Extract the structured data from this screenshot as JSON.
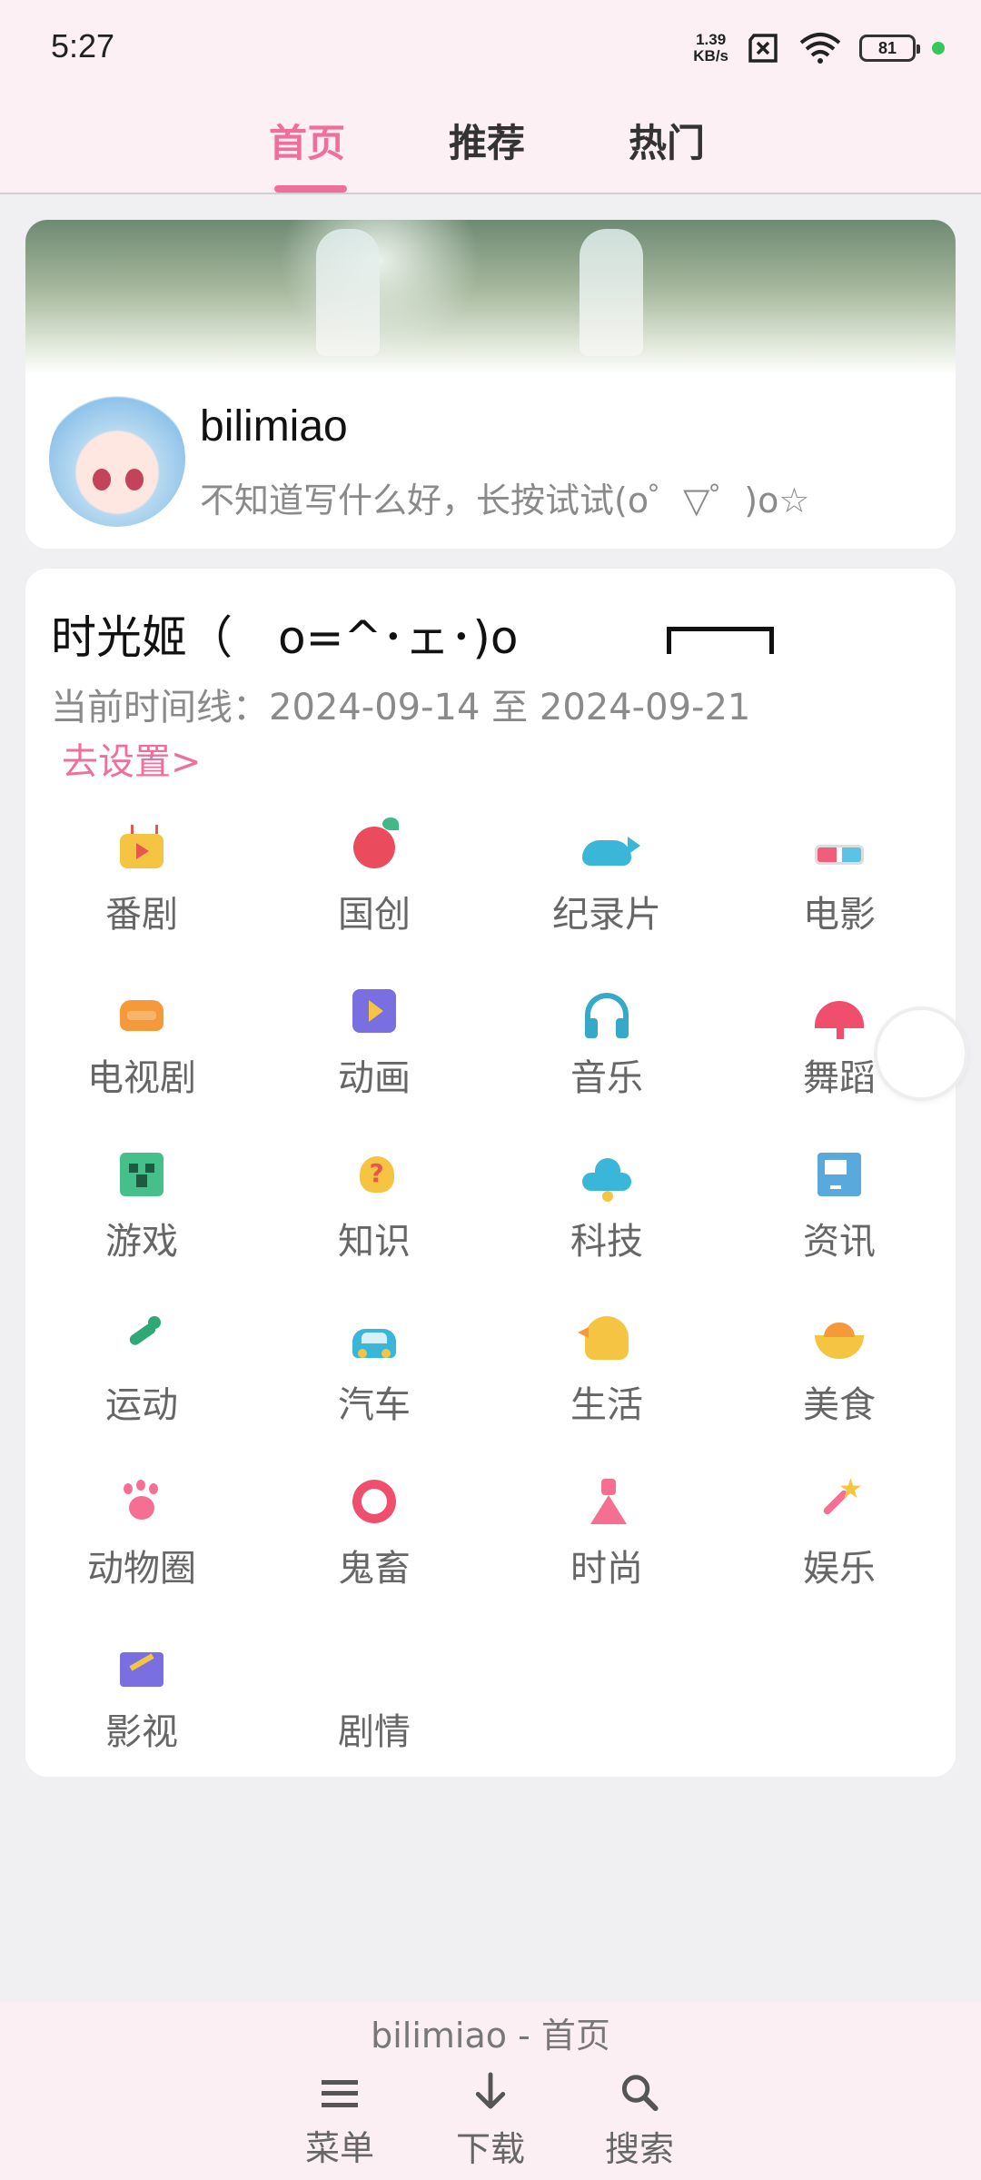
{
  "status_bar": {
    "time": "5:27",
    "net_speed_value": "1.39",
    "net_speed_unit": "KB/s",
    "battery": "81"
  },
  "tabs": [
    {
      "label": "首页",
      "active": true
    },
    {
      "label": "推荐",
      "active": false
    },
    {
      "label": "热门",
      "active": false
    }
  ],
  "profile": {
    "username": "bilimiao",
    "bio": "不知道写什么好，长按试试(o゜▽゜)o☆"
  },
  "timeline_card": {
    "title": "时光姬（　o=^･ェ･)o　",
    "timeline_text": "当前时间线：2024-09-14 至 2024-09-21",
    "settings_link": "去设置>"
  },
  "categories": [
    {
      "label": "番剧",
      "icon": "tv-icon"
    },
    {
      "label": "国创",
      "icon": "gourd-icon"
    },
    {
      "label": "纪录片",
      "icon": "whale-icon"
    },
    {
      "label": "电影",
      "icon": "3d-glasses-icon"
    },
    {
      "label": "电视剧",
      "icon": "sofa-icon"
    },
    {
      "label": "动画",
      "icon": "play-icon"
    },
    {
      "label": "音乐",
      "icon": "headphones-icon"
    },
    {
      "label": "舞蹈",
      "icon": "fan-icon"
    },
    {
      "label": "游戏",
      "icon": "creeper-icon"
    },
    {
      "label": "知识",
      "icon": "lightbulb-icon"
    },
    {
      "label": "科技",
      "icon": "ufo-icon"
    },
    {
      "label": "资讯",
      "icon": "newspaper-icon"
    },
    {
      "label": "运动",
      "icon": "runner-icon"
    },
    {
      "label": "汽车",
      "icon": "car-icon"
    },
    {
      "label": "生活",
      "icon": "duck-icon"
    },
    {
      "label": "美食",
      "icon": "food-bowl-icon"
    },
    {
      "label": "动物圈",
      "icon": "paw-icon"
    },
    {
      "label": "鬼畜",
      "icon": "clown-icon"
    },
    {
      "label": "时尚",
      "icon": "dress-icon"
    },
    {
      "label": "娱乐",
      "icon": "magic-wand-icon"
    },
    {
      "label": "影视",
      "icon": "clapperboard-icon"
    },
    {
      "label": "剧情",
      "icon": ""
    }
  ],
  "bottom_bar": {
    "title": "bilimiao - 首页",
    "buttons": [
      {
        "label": "菜单",
        "icon": "menu-icon"
      },
      {
        "label": "下载",
        "icon": "download-icon"
      },
      {
        "label": "搜索",
        "icon": "search-icon"
      }
    ]
  },
  "colors": {
    "accent": "#ef6f9a",
    "header_bg": "#fcf0f5",
    "page_bg": "#f0eff2"
  }
}
